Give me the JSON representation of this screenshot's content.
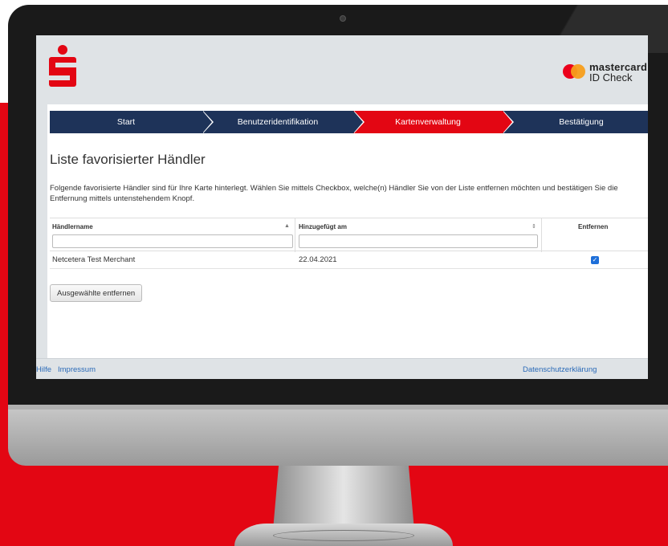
{
  "header": {
    "bank_logo": "sparkasse-logo",
    "brand": "mastercard",
    "brand_sub": "ID Check",
    "colors": {
      "brand_red": "#e30613",
      "nav_blue": "#1e3359"
    }
  },
  "steps": [
    {
      "label": "Start",
      "active": false
    },
    {
      "label": "Benutzeridentifikation",
      "active": false
    },
    {
      "label": "Kartenverwaltung",
      "active": true
    },
    {
      "label": "Bestätigung",
      "active": false
    }
  ],
  "page": {
    "title": "Liste favorisierter Händler",
    "description": "Folgende favorisierte Händler sind für Ihre Karte hinterlegt. Wählen Sie mittels Checkbox, welche(n) Händler Sie von der Liste entfernen möchten und bestätigen Sie die Entfernung mittels untenstehendem Knopf."
  },
  "table": {
    "headers": {
      "name": "Händlername",
      "added": "Hinzugefügt am",
      "remove": "Entfernen"
    },
    "filters": {
      "name": "",
      "added": ""
    },
    "rows": [
      {
        "name": "Netcetera Test Merchant",
        "added": "22.04.2021",
        "remove_checked": true
      }
    ]
  },
  "actions": {
    "remove_selected": "Ausgewählte entfernen"
  },
  "footer": {
    "help": "Hilfe",
    "imprint": "Impressum",
    "privacy": "Datenschutzerklärung"
  }
}
